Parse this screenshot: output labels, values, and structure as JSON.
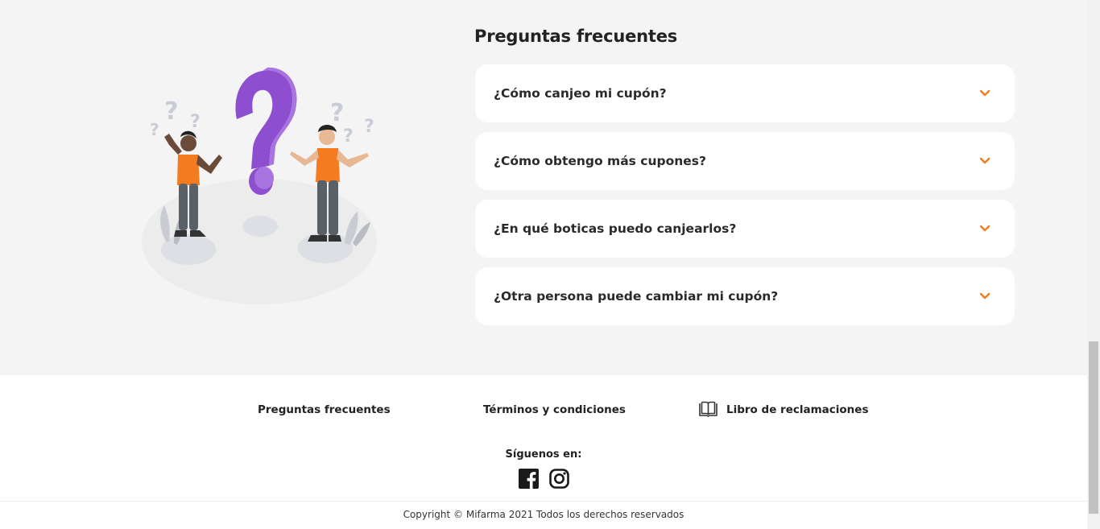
{
  "faq": {
    "title": "Preguntas frecuentes",
    "accent_color": "#f47b20",
    "items": [
      {
        "question": "¿Cómo canjeo mi cupón?",
        "icon": "chevron-down-icon"
      },
      {
        "question": "¿Cómo obtengo más cupones?",
        "icon": "chevron-down-icon"
      },
      {
        "question": "¿En qué boticas puedo canjearlos?",
        "icon": "chevron-down-icon"
      },
      {
        "question": "¿Otra persona puede cambiar mi cupón?",
        "icon": "chevron-down-icon"
      }
    ]
  },
  "illustration": {
    "icon": "people-question-illustration",
    "colors": {
      "question_mark": "#9b59d6",
      "shirt": "#f47b20"
    }
  },
  "footer": {
    "links": {
      "faq": "Preguntas frecuentes",
      "terms": "Términos y condiciones",
      "complaints_book": "Libro de reclamaciones"
    },
    "follow_label": "Síguenos en:",
    "social_icons": [
      "facebook-icon",
      "instagram-icon"
    ],
    "copyright": "Copyright © Mifarma 2021 Todos los derechos reservados"
  }
}
